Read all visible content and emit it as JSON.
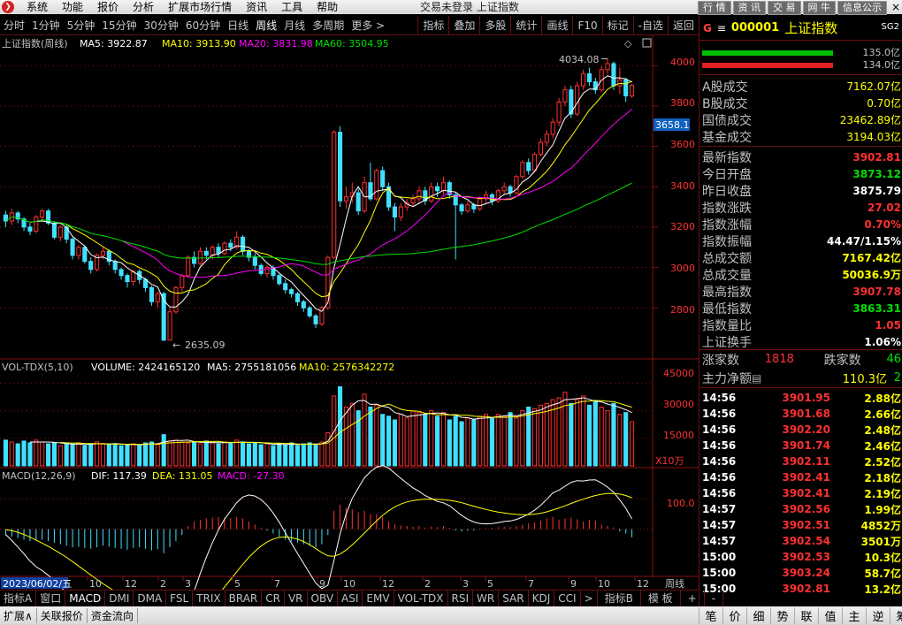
{
  "menubar": {
    "logo": "❯",
    "items": [
      "系统",
      "功能",
      "报价",
      "分析",
      "扩展市场行情",
      "资讯",
      "工具",
      "帮助"
    ],
    "center_text": "交易未登录  上证指数",
    "right_buttons": [
      "行 情",
      "资 讯",
      "交 易",
      "网 牛",
      "信息公示"
    ],
    "close_label": "×"
  },
  "period_bar": {
    "items": [
      "分时",
      "1分钟",
      "5分钟",
      "15分钟",
      "30分钟",
      "60分钟",
      "日线",
      "周线",
      "月线",
      "多周期",
      "更多 >"
    ],
    "selected": "周线",
    "tools": [
      "指标",
      "叠加",
      "多股",
      "统计",
      "画线",
      "F10",
      "标记",
      "-自选",
      "返回"
    ]
  },
  "main_legend": {
    "title": "上证指数(周线)",
    "ma5": "MA5: 3922.87",
    "ma10": "MA10: 3913.90",
    "ma20": "MA20: 3831.98",
    "ma60": "MA60: 3504.95"
  },
  "vol_legend": {
    "title": "VOL-TDX(5,10)",
    "volume": "VOLUME: 2424165120",
    "ma5": "MA5: 2755181056",
    "ma10": "MA10: 2576342272"
  },
  "macd_legend": {
    "title": "MACD(12,26,9)",
    "dif": "DIF: 117.39",
    "dea": "DEA: 131.05",
    "macd": "MACD: -27.30"
  },
  "price_axis": {
    "ticks": [
      "4000",
      "3800",
      "3600",
      "3400",
      "3200",
      "3000",
      "2800"
    ],
    "current": "3658.1",
    "high_label": "4034.08",
    "low_label": "2635.09"
  },
  "vol_axis": {
    "ticks": [
      "45000",
      "30000",
      "15000"
    ],
    "unit": "X10万"
  },
  "macd_axis": {
    "ticks": [
      "100.0"
    ]
  },
  "x_axis": {
    "date_box": "2023/06/02/五",
    "ticks": [
      "10",
      "12",
      "2",
      "3",
      "5",
      "7",
      "9",
      "10",
      "12",
      "2",
      "3",
      "5",
      "7",
      "9",
      "10",
      "12"
    ],
    "right_label": "周线"
  },
  "colors": {
    "up": "#ff3030",
    "down": "#40e0ff",
    "ma5": "#ffffff",
    "ma10": "#ffff00",
    "ma20": "#ff00ff",
    "ma60": "#00e000",
    "grid": "#8a1010"
  },
  "right_panel": {
    "g_label": "G",
    "menu_icon": "≡",
    "code": "000001",
    "name": "上证指数",
    "sg": "SG2",
    "bar_values": [
      "135.0亿",
      "134.0亿"
    ],
    "stats1": [
      {
        "k": "A股成交",
        "v": "7162.07亿"
      },
      {
        "k": "B股成交",
        "v": "0.70亿"
      },
      {
        "k": "国债成交",
        "v": "23462.89亿"
      },
      {
        "k": "基金成交",
        "v": "3194.03亿"
      }
    ],
    "stats2": [
      {
        "k": "最新指数",
        "v": "3902.81",
        "c": "red"
      },
      {
        "k": "今日开盘",
        "v": "3873.12",
        "c": "grn"
      },
      {
        "k": "昨日收盘",
        "v": "3875.79",
        "c": "wht"
      },
      {
        "k": "指数涨跌",
        "v": "27.02",
        "c": "red"
      },
      {
        "k": "指数涨幅",
        "v": "0.70%",
        "c": "red"
      },
      {
        "k": "指数振幅",
        "v": "44.47/1.15%",
        "c": "wht"
      },
      {
        "k": "总成交额",
        "v": "7167.42亿",
        "c": "ylw"
      },
      {
        "k": "总成交量",
        "v": "50036.9万",
        "c": "ylw"
      },
      {
        "k": "最高指数",
        "v": "3907.78",
        "c": "red"
      },
      {
        "k": "最低指数",
        "v": "3863.31",
        "c": "grn"
      },
      {
        "k": "指数量比",
        "v": "1.05",
        "c": "red"
      },
      {
        "k": "上证换手",
        "v": "1.06%",
        "c": "wht"
      }
    ],
    "up_label": "涨家数",
    "up_value": "1818",
    "down_label": "跌家数",
    "down_value": "46",
    "flow_label": "主力净额",
    "flow_value": "110.3亿",
    "flow_extra": "2",
    "ticks": [
      {
        "t": "14:56",
        "p": "3901.95",
        "q": "2.88亿"
      },
      {
        "t": "14:56",
        "p": "3901.68",
        "q": "2.66亿"
      },
      {
        "t": "14:56",
        "p": "3902.20",
        "q": "2.48亿"
      },
      {
        "t": "14:56",
        "p": "3901.74",
        "q": "2.46亿"
      },
      {
        "t": "14:56",
        "p": "3902.11",
        "q": "2.52亿"
      },
      {
        "t": "14:56",
        "p": "3902.41",
        "q": "2.18亿"
      },
      {
        "t": "14:56",
        "p": "3902.41",
        "q": "2.19亿"
      },
      {
        "t": "14:57",
        "p": "3902.56",
        "q": "1.99亿"
      },
      {
        "t": "14:57",
        "p": "3902.51",
        "q": "4852万"
      },
      {
        "t": "14:57",
        "p": "3902.54",
        "q": "3501万"
      },
      {
        "t": "15:00",
        "p": "3902.53",
        "q": "10.3亿"
      },
      {
        "t": "15:00",
        "p": "3903.24",
        "q": "58.7亿"
      },
      {
        "t": "15:00",
        "p": "3902.81",
        "q": "13.2亿"
      }
    ]
  },
  "bottom_tabs": {
    "items": [
      "指标A",
      "窗口",
      "MACD",
      "DMI",
      "DMA",
      "FSL",
      "TRIX",
      "BRAR",
      "CR",
      "VR",
      "OBV",
      "ASI",
      "EMV",
      "VOL-TDX",
      "RSI",
      "WR",
      "SAR",
      "KDJ",
      "CCI",
      ">"
    ],
    "selected": "MACD",
    "right": [
      "指标B",
      "模 板",
      "+",
      "-"
    ]
  },
  "status_bar": {
    "items": [
      "扩展∧",
      "关联报价",
      "资金流向"
    ],
    "right": [
      "笔",
      "价",
      "细",
      "势",
      "联",
      "值",
      "主",
      "逆",
      "筹"
    ]
  },
  "chart_data": {
    "type": "candlestick",
    "price_range": [
      2560,
      4080
    ],
    "volume_range": [
      0,
      50000
    ],
    "macd_range": [
      -150,
      170
    ],
    "weeks": 104,
    "candles": [
      [
        3260,
        3230,
        3280,
        3200
      ],
      [
        3230,
        3270,
        3290,
        3210
      ],
      [
        3270,
        3240,
        3280,
        3220
      ],
      [
        3240,
        3200,
        3250,
        3180
      ],
      [
        3200,
        3180,
        3220,
        3160
      ],
      [
        3180,
        3250,
        3260,
        3170
      ],
      [
        3250,
        3280,
        3290,
        3230
      ],
      [
        3280,
        3220,
        3290,
        3210
      ],
      [
        3220,
        3150,
        3230,
        3140
      ],
      [
        3150,
        3200,
        3210,
        3130
      ],
      [
        3200,
        3140,
        3210,
        3120
      ],
      [
        3140,
        3060,
        3150,
        3040
      ],
      [
        3060,
        3100,
        3110,
        3040
      ],
      [
        3100,
        3030,
        3110,
        3020
      ],
      [
        3030,
        2990,
        3050,
        2970
      ],
      [
        2990,
        3060,
        3070,
        2980
      ],
      [
        3060,
        3080,
        3100,
        3040
      ],
      [
        3080,
        3030,
        3090,
        3010
      ],
      [
        3030,
        2990,
        3040,
        2970
      ],
      [
        2990,
        2960,
        3000,
        2940
      ],
      [
        2960,
        2930,
        2970,
        2900
      ],
      [
        2930,
        2980,
        2990,
        2910
      ],
      [
        2980,
        2940,
        2990,
        2920
      ],
      [
        2940,
        2900,
        2950,
        2880
      ],
      [
        2900,
        2830,
        2910,
        2810
      ],
      [
        2830,
        2870,
        2880,
        2800
      ],
      [
        2870,
        2640,
        2880,
        2635
      ],
      [
        2640,
        2780,
        2800,
        2640
      ],
      [
        2780,
        2900,
        2910,
        2770
      ],
      [
        2900,
        2960,
        2970,
        2880
      ],
      [
        2960,
        3050,
        3060,
        2950
      ],
      [
        3050,
        3020,
        3080,
        3000
      ],
      [
        3020,
        3080,
        3100,
        3010
      ],
      [
        3080,
        3060,
        3100,
        3040
      ],
      [
        3060,
        3100,
        3110,
        3040
      ],
      [
        3100,
        3070,
        3120,
        3050
      ],
      [
        3070,
        3120,
        3130,
        3060
      ],
      [
        3120,
        3100,
        3140,
        3080
      ],
      [
        3100,
        3150,
        3180,
        3090
      ],
      [
        3150,
        3080,
        3160,
        3060
      ],
      [
        3080,
        3050,
        3090,
        3030
      ],
      [
        3050,
        3010,
        3070,
        2990
      ],
      [
        3010,
        2970,
        3020,
        2960
      ],
      [
        2970,
        3000,
        3010,
        2950
      ],
      [
        3000,
        2960,
        3010,
        2940
      ],
      [
        2960,
        2920,
        2970,
        2910
      ],
      [
        2920,
        2890,
        2940,
        2870
      ],
      [
        2890,
        2870,
        2900,
        2850
      ],
      [
        2870,
        2830,
        2880,
        2810
      ],
      [
        2830,
        2800,
        2840,
        2780
      ],
      [
        2800,
        2760,
        2810,
        2750
      ],
      [
        2760,
        2720,
        2770,
        2700
      ],
      [
        2720,
        2800,
        2810,
        2710
      ],
      [
        2800,
        3050,
        3060,
        2790
      ],
      [
        3050,
        3670,
        3680,
        3040
      ],
      [
        3670,
        3330,
        3700,
        3300
      ],
      [
        3330,
        3350,
        3400,
        3290
      ],
      [
        3350,
        3370,
        3420,
        3320
      ],
      [
        3370,
        3280,
        3390,
        3260
      ],
      [
        3280,
        3420,
        3450,
        3270
      ],
      [
        3420,
        3340,
        3520,
        3330
      ],
      [
        3340,
        3480,
        3490,
        3330
      ],
      [
        3480,
        3400,
        3500,
        3380
      ],
      [
        3400,
        3300,
        3420,
        3280
      ],
      [
        3300,
        3250,
        3320,
        3180
      ],
      [
        3250,
        3300,
        3320,
        3230
      ],
      [
        3300,
        3320,
        3340,
        3280
      ],
      [
        3320,
        3340,
        3360,
        3300
      ],
      [
        3340,
        3380,
        3400,
        3320
      ],
      [
        3380,
        3330,
        3400,
        3310
      ],
      [
        3330,
        3400,
        3420,
        3320
      ],
      [
        3400,
        3380,
        3420,
        3350
      ],
      [
        3380,
        3420,
        3450,
        3360
      ],
      [
        3420,
        3360,
        3430,
        3340
      ],
      [
        3360,
        3310,
        3370,
        3040
      ],
      [
        3310,
        3280,
        3320,
        3260
      ],
      [
        3280,
        3310,
        3330,
        3270
      ],
      [
        3310,
        3290,
        3320,
        3270
      ],
      [
        3290,
        3340,
        3350,
        3280
      ],
      [
        3340,
        3360,
        3380,
        3320
      ],
      [
        3360,
        3330,
        3370,
        3310
      ],
      [
        3330,
        3380,
        3390,
        3320
      ],
      [
        3380,
        3400,
        3420,
        3360
      ],
      [
        3400,
        3370,
        3410,
        3350
      ],
      [
        3370,
        3450,
        3460,
        3360
      ],
      [
        3450,
        3520,
        3530,
        3440
      ],
      [
        3520,
        3480,
        3540,
        3460
      ],
      [
        3480,
        3560,
        3570,
        3470
      ],
      [
        3560,
        3620,
        3640,
        3550
      ],
      [
        3620,
        3660,
        3680,
        3600
      ],
      [
        3660,
        3720,
        3740,
        3640
      ],
      [
        3720,
        3820,
        3840,
        3700
      ],
      [
        3820,
        3880,
        3900,
        3800
      ],
      [
        3880,
        3760,
        3900,
        3740
      ],
      [
        3760,
        3900,
        3920,
        3750
      ],
      [
        3900,
        3960,
        3980,
        3880
      ],
      [
        3960,
        3920,
        3990,
        3900
      ],
      [
        3920,
        3880,
        3940,
        3860
      ],
      [
        3880,
        3980,
        4000,
        3870
      ],
      [
        3980,
        4010,
        4034,
        3960
      ],
      [
        4010,
        3900,
        4020,
        3880
      ],
      [
        3900,
        3930,
        3990,
        3860
      ],
      [
        3930,
        3850,
        3940,
        3820
      ],
      [
        3850,
        3902,
        3910,
        3840
      ]
    ],
    "volumes": [
      14000,
      13000,
      12000,
      13500,
      12500,
      14000,
      13000,
      12000,
      12500,
      11000,
      12000,
      11500,
      12500,
      11000,
      12000,
      13000,
      12000,
      11500,
      12000,
      11000,
      11500,
      12000,
      11000,
      12500,
      13000,
      11500,
      17000,
      13500,
      14000,
      13000,
      12500,
      13000,
      12000,
      13500,
      12500,
      12000,
      13000,
      12500,
      14000,
      13000,
      12000,
      12500,
      11500,
      12000,
      11000,
      12000,
      11500,
      12500,
      11000,
      12000,
      12500,
      11500,
      13000,
      18000,
      38000,
      43000,
      32000,
      34000,
      30000,
      39000,
      32000,
      33000,
      28000,
      27000,
      25000,
      28000,
      26000,
      30000,
      29000,
      28000,
      30000,
      27000,
      29000,
      25000,
      27000,
      24000,
      26000,
      25000,
      27000,
      28000,
      26000,
      28000,
      27000,
      29000,
      26000,
      30000,
      32000,
      31000,
      33000,
      34000,
      36000,
      37000,
      40000,
      34000,
      36000,
      38000,
      33000,
      35000,
      32000,
      30000,
      34000,
      28000,
      29000,
      24000
    ],
    "macd_hist": [
      -20,
      -25,
      -30,
      -35,
      -40,
      -38,
      -35,
      -40,
      -45,
      -50,
      -55,
      -60,
      -58,
      -62,
      -65,
      -60,
      -55,
      -58,
      -62,
      -65,
      -68,
      -62,
      -60,
      -65,
      -70,
      -66,
      -80,
      -60,
      -40,
      -20,
      10,
      25,
      30,
      35,
      38,
      40,
      38,
      36,
      40,
      35,
      25,
      15,
      5,
      -5,
      -15,
      -25,
      -35,
      -40,
      -45,
      -50,
      -55,
      -60,
      -50,
      -20,
      60,
      80,
      70,
      65,
      55,
      60,
      50,
      48,
      40,
      25,
      15,
      12,
      10,
      8,
      10,
      5,
      8,
      6,
      10,
      4,
      -5,
      -8,
      -6,
      -5,
      -2,
      2,
      4,
      6,
      8,
      6,
      10,
      14,
      18,
      22,
      28,
      35,
      40,
      30,
      35,
      38,
      32,
      25,
      30,
      28,
      15,
      10,
      5,
      -8,
      -15,
      -27.3
    ]
  }
}
